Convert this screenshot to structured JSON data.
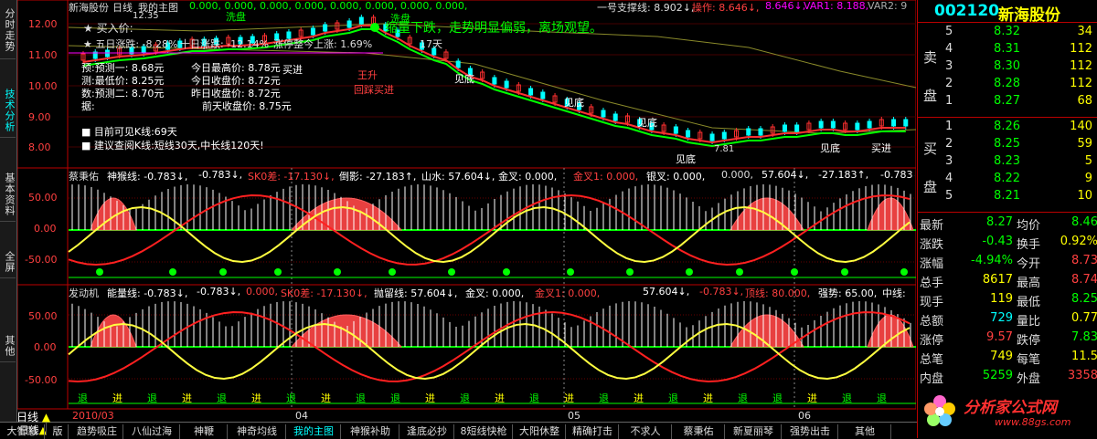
{
  "left_tabs": [
    {
      "label": "分时走势"
    },
    {
      "label": "技术分析",
      "active": true
    },
    {
      "label": "基本资料"
    },
    {
      "label": "全屏"
    },
    {
      "label": "其他"
    }
  ],
  "header": {
    "stock_name": "新海股份",
    "period": "日线",
    "layout": "我的主图",
    "values": "0.000, 0.000, 0.000, 0.000, 0.000, 0.000, 0.000, 0.000,",
    "support_label": "一号支撑线: 8.902↓,",
    "op_label": "操作: 8.646↓,",
    "op_val2": "8.646↓,",
    "var1": "VAR1: 8.188,",
    "var2": "VAR2: 9",
    "price_top": "12.35"
  },
  "main_chart": {
    "y_ticks": [
      "12.00",
      "11.00",
      "10.00",
      "9.00",
      "8.00"
    ],
    "buy_price_label": "买入价:",
    "five_day": "五日涨跌: -8.28%",
    "ten_day": "十日涨跌: -12.14%",
    "limit_up": "涨停整今上涨: 1.69%",
    "days": "17天",
    "msg": "缩量下跌，走势明显偏弱，离场观望。",
    "info_lines": [
      {
        "l": "预:预测一: 8.68元",
        "r": "今日最高价: 8.78元"
      },
      {
        "l": "测:最低价: 8.25元",
        "r": "今日收盘价: 8.72元"
      },
      {
        "l": "数:预测二: 8.70元",
        "r": "昨日收盘价: 8.72元"
      },
      {
        "l": "据:",
        "r": "前天收盘价: 8.75元"
      }
    ],
    "cycle": "目前可见K线:69天",
    "advice": "建议查阅K线:短线30天,中长线120天!",
    "annot_xipan1": "洗盘",
    "annot_xipan2": "洗盘",
    "annot_jinjin": "买进",
    "annot_wangsheng": "王升",
    "annot_huijiang": "回踩买进",
    "annot_jiandi1": "见底",
    "annot_jiandi2": "见底",
    "annot_jiandi3": "见底",
    "annot_jiandi4": "见底",
    "annot_jiandi5": "见底",
    "annot_maijin": "买进",
    "low_price": "7.81"
  },
  "sub1": {
    "title": "蔡秉佑",
    "line1": "神猴线: -0.783↓,",
    "line2": "-0.783↓,",
    "line3": "SK0差: -17.130↓,",
    "line4": "倒影: -27.183↑,",
    "line5": "山水: 57.604↓,",
    "line6": "金叉: 0.000,",
    "line7": "金叉1: 0.000,",
    "line8": "银叉: 0.000,",
    "line9": "0.000,",
    "line10": "57.604↓,",
    "line11": "-27.183↑,",
    "line12": "-0.783↓,",
    "y_ticks": [
      "50.00",
      "0.00",
      "-50.00"
    ]
  },
  "sub2": {
    "title": "发动机",
    "line1": "能量线: -0.783↓,",
    "line2": "-0.783↓,",
    "line3": "0.000,",
    "line4": "SK0差: -17.130↓,",
    "line5": "抛留线: 57.604↓,",
    "line6": "金叉: 0.000,",
    "line7": "金叉1: 0.000,",
    "line8": "57.604↓,",
    "line9": "-0.783↓,",
    "line10": "顶线: 80.000,",
    "line11": "强势: 65.00,",
    "line12": "中线:",
    "y_ticks": [
      "50.00",
      "0.00",
      "-50.00"
    ],
    "signals": [
      "退",
      "进",
      "退",
      "进",
      "退",
      "进",
      "退",
      "进",
      "退",
      "退",
      "进",
      "退",
      "进",
      "退",
      "进",
      "退",
      "进",
      "退",
      "进",
      "退",
      "退",
      "进",
      "退",
      "退"
    ]
  },
  "date_axis": [
    "2010/03",
    "04",
    "05",
    "06"
  ],
  "bottom_tabs": [
    "日线",
    "大智慧",
    "版",
    "趋势吸庄",
    "八仙过海",
    "神鞭",
    "神奇均线",
    "我的主图",
    "神猴补助",
    "逢底必抄",
    "8短线快枪",
    "大阳休整",
    "精确打击",
    "不求人",
    "蔡秉佑",
    "新夏丽琴",
    "强势出击",
    "其他"
  ],
  "right_panel": {
    "code": "002120",
    "name": "新海股份",
    "sell_label": "卖盘",
    "buy_label": "买盘",
    "asks": [
      {
        "n": "5",
        "p": "8.32",
        "v": "34"
      },
      {
        "n": "4",
        "p": "8.31",
        "v": "112"
      },
      {
        "n": "3",
        "p": "8.30",
        "v": "112"
      },
      {
        "n": "2",
        "p": "8.28",
        "v": "112"
      },
      {
        "n": "1",
        "p": "8.27",
        "v": "68"
      }
    ],
    "bids": [
      {
        "n": "1",
        "p": "8.26",
        "v": "140"
      },
      {
        "n": "2",
        "p": "8.25",
        "v": "59"
      },
      {
        "n": "3",
        "p": "8.23",
        "v": "5"
      },
      {
        "n": "4",
        "p": "8.22",
        "v": "9"
      },
      {
        "n": "5",
        "p": "8.21",
        "v": "10"
      }
    ],
    "stats": [
      {
        "l": "最新",
        "v": "8.27",
        "vc": "#00ff00",
        "l2": "均价",
        "v2": "8.46",
        "v2c": "#00ff00"
      },
      {
        "l": "涨跌",
        "v": "-0.43",
        "vc": "#00ff00",
        "l2": "换手",
        "v2": "0.92%",
        "v2c": "#ffff00"
      },
      {
        "l": "涨幅",
        "v": "-4.94%",
        "vc": "#00ff00",
        "l2": "今开",
        "v2": "8.73",
        "v2c": "#ff4040"
      },
      {
        "l": "总手",
        "v": "8617",
        "vc": "#ffff00",
        "l2": "最高",
        "v2": "8.74",
        "v2c": "#ff4040"
      },
      {
        "l": "现手",
        "v": "119",
        "vc": "#ffff00",
        "l2": "最低",
        "v2": "8.25",
        "v2c": "#00ff00"
      },
      {
        "l": "总额",
        "v": "729",
        "vc": "#00ffff",
        "l2": "量比",
        "v2": "0.77",
        "v2c": "#ffff00"
      },
      {
        "l": "涨停",
        "v": "9.57",
        "vc": "#ff4040",
        "l2": "跌停",
        "v2": "7.83",
        "v2c": "#00ff00"
      },
      {
        "l": "总笔",
        "v": "749",
        "vc": "#ffff00",
        "l2": "每笔",
        "v2": "11.5",
        "v2c": "#ffff00"
      },
      {
        "l": "内盘",
        "v": "5259",
        "vc": "#00ff00",
        "l2": "外盘",
        "v2": "3358",
        "v2c": "#ff4040"
      }
    ],
    "watermark": "分析家公式网",
    "watermark_url": "www.88gs.com"
  }
}
